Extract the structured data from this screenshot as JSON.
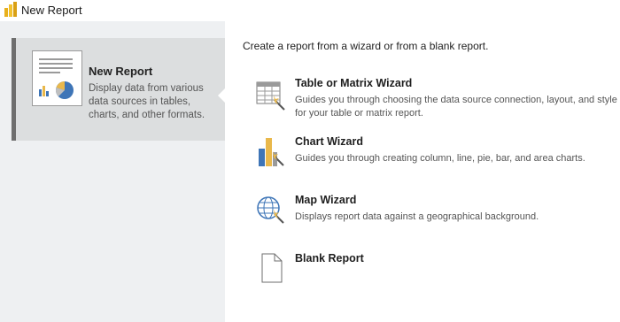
{
  "window": {
    "title": "New Report",
    "app_icon": "report-builder-icon"
  },
  "sidebar": {
    "items": [
      {
        "title": "New Report",
        "description": "Display data from various data sources in tables, charts, and other formats.",
        "icon": "report-thumbnail-icon",
        "selected": true
      }
    ]
  },
  "main": {
    "heading": "Create a report from a wizard or from a blank report.",
    "options": [
      {
        "title": "Table or Matrix Wizard",
        "description": "Guides you through choosing the data source connection, layout, and style for your table or matrix report.",
        "icon": "table-wizard-icon"
      },
      {
        "title": "Chart Wizard",
        "description": "Guides you through creating column, line, pie, bar, and area charts.",
        "icon": "chart-wizard-icon"
      },
      {
        "title": "Map Wizard",
        "description": "Displays report data against a geographical background.",
        "icon": "map-wizard-icon"
      },
      {
        "title": "Blank Report",
        "description": "",
        "icon": "blank-document-icon"
      }
    ]
  },
  "colors": {
    "sidebar_bg": "#eef0f2",
    "selected_bg": "#dcdedf",
    "accent_bar": "#6e6e6e",
    "chart_blue": "#3e75b7",
    "chart_gold": "#e9b84b"
  }
}
